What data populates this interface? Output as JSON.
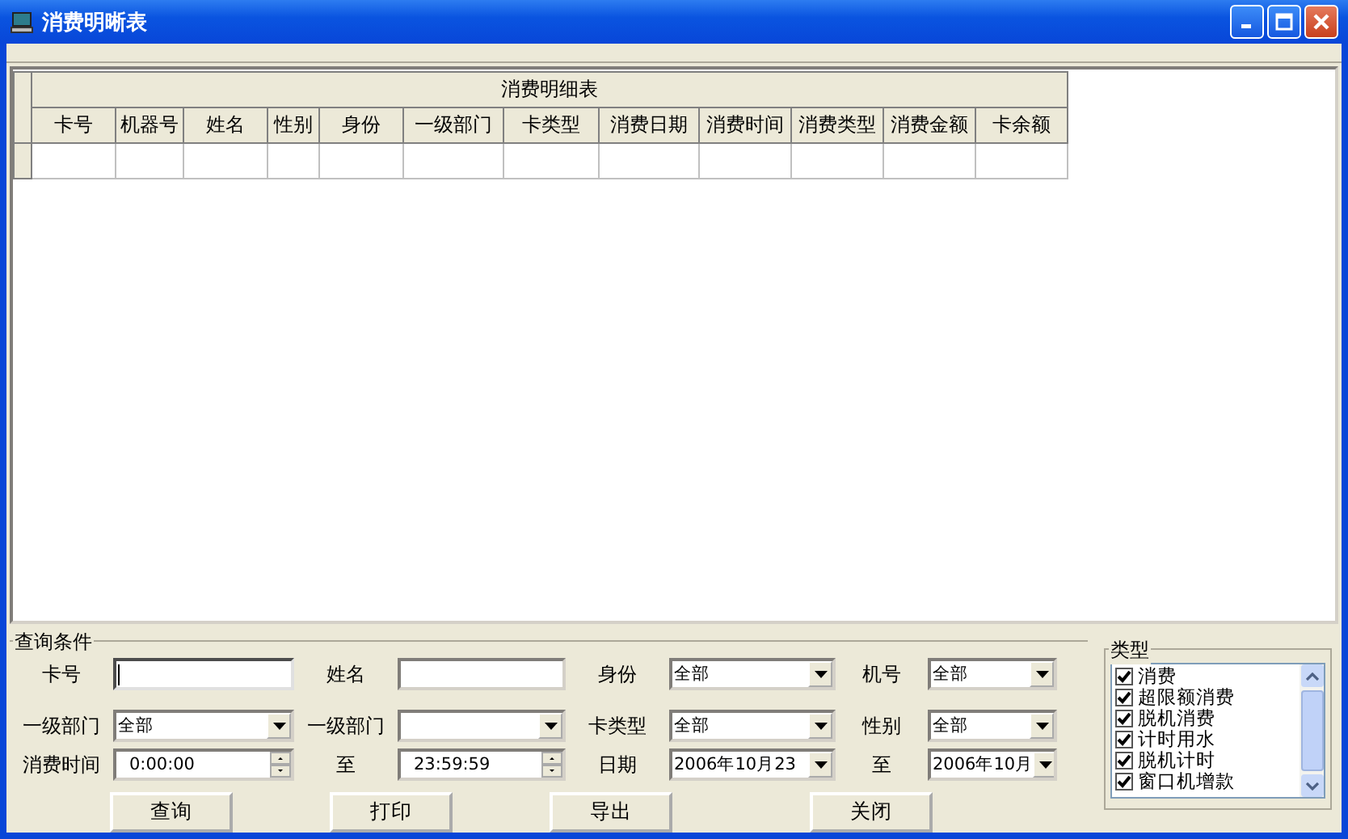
{
  "window": {
    "title": "消费明晰表"
  },
  "table": {
    "title": "消费明细表",
    "columns": [
      "卡号",
      "机器号",
      "姓名",
      "性别",
      "身份",
      "一级部门",
      "卡类型",
      "消费日期",
      "消费时间",
      "消费类型",
      "消费金额",
      "卡余额"
    ]
  },
  "query": {
    "title": "查询条件",
    "fields": [
      {
        "label": "卡号",
        "kind": "text",
        "focused": true
      },
      {
        "label": "姓名",
        "kind": "text",
        "focused": false
      },
      {
        "label": "身份",
        "kind": "combo",
        "value": "全部"
      },
      {
        "label": "机号",
        "kind": "combo",
        "value": "全部"
      },
      {
        "label": "一级部门",
        "kind": "combo",
        "value": "全部"
      },
      {
        "label": "一级部门",
        "kind": "combo"
      },
      {
        "label": "卡类型",
        "kind": "combo",
        "value": "全部"
      },
      {
        "label": "性别",
        "kind": "combo",
        "value": "全部"
      },
      {
        "label": "消费时间",
        "kind": "spin",
        "value": "0:00:00"
      },
      {
        "label": "至",
        "kind": "spin",
        "value": "23:59:59"
      },
      {
        "label": "日期",
        "kind": "combo",
        "value": "2006年10月23"
      },
      {
        "label": "至",
        "kind": "combo",
        "value": "2006年10月"
      }
    ],
    "buttons": [
      "查询",
      "打印",
      "导出",
      "关闭"
    ]
  },
  "types": {
    "title": "类型",
    "items": [
      {
        "label": "消费",
        "checked": true
      },
      {
        "label": "超限额消费",
        "checked": true
      },
      {
        "label": "脱机消费",
        "checked": true
      },
      {
        "label": "计时用水",
        "checked": true
      },
      {
        "label": "脱机计时",
        "checked": true
      },
      {
        "label": "窗口机增款",
        "checked": true
      }
    ]
  }
}
